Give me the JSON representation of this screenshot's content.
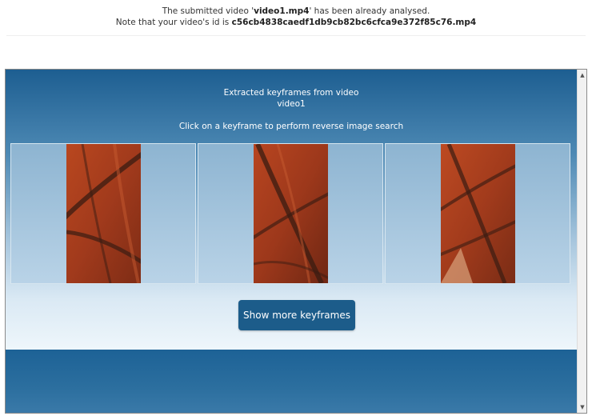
{
  "notice": {
    "line1_prefix": "The submitted video '",
    "filename": "video1.mp4",
    "line1_suffix": "' has been already analysed.",
    "line2_prefix": "Note that your video's id is ",
    "video_id": "c56cb4838caedf1db9cb82bc6cfca9e372f85c76.mp4"
  },
  "panel": {
    "heading": "Extracted keyframes from video",
    "video_name": "video1",
    "instruction": "Click on a keyframe to perform reverse image search",
    "more_button": "Show more keyframes"
  },
  "scrollbar": {
    "up_icon": "chevron-up-icon",
    "down_icon": "chevron-down-icon"
  },
  "colors": {
    "button_bg": "#1c5c8a",
    "keyframe_red": "#a8391c"
  }
}
